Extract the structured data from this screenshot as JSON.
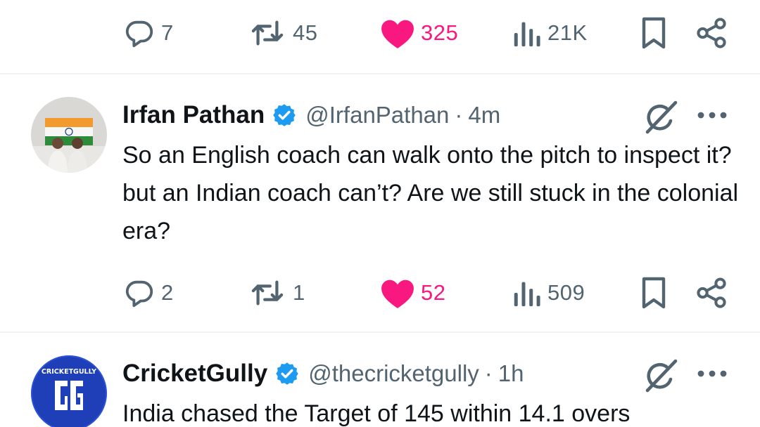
{
  "actions_top": {
    "replies": "7",
    "reposts": "45",
    "likes": "325",
    "views": "21K"
  },
  "tweets": [
    {
      "display_name": "Irfan Pathan",
      "handle": "@IrfanPathan",
      "separator": "·",
      "time": "4m",
      "text": "So an English coach can walk onto the pitch to inspect it? but an Indian coach can’t? Are we still stuck in the colonial era?",
      "actions": {
        "replies": "2",
        "reposts": "1",
        "likes": "52",
        "views": "509"
      }
    },
    {
      "display_name": "CricketGully",
      "handle": "@thecricketgully",
      "separator": "·",
      "time": "1h",
      "avatar_logo_text": "CRICKETGULLY",
      "text": "India chased the Target of 145 within 14.1 overs"
    }
  ],
  "colors": {
    "text_primary": "#0f1419",
    "text_secondary": "#536471",
    "like_pink": "#f91880",
    "verified_blue": "#1d9bf0",
    "divider": "#eff3f4"
  },
  "icons": [
    "reply-icon",
    "repost-icon",
    "like-heart-icon",
    "views-icon",
    "bookmark-icon",
    "share-icon",
    "verified-badge-icon",
    "grok-icon",
    "more-icon"
  ]
}
